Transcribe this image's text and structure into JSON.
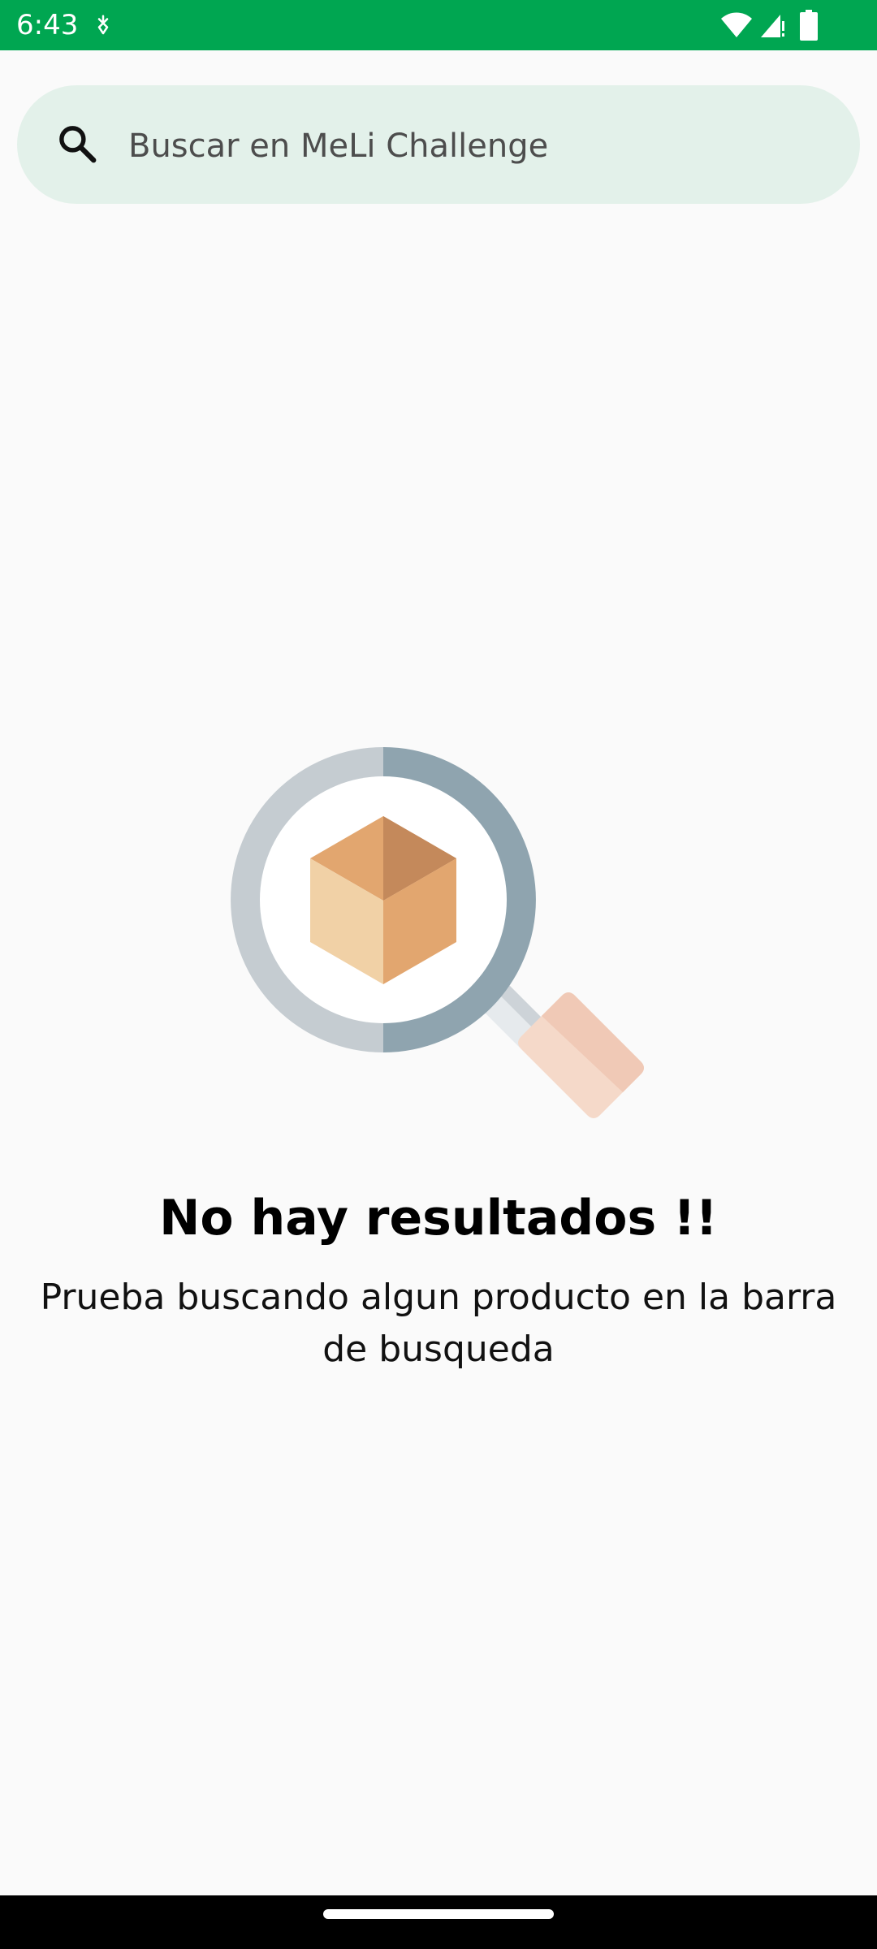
{
  "status_bar": {
    "time": "6:43",
    "color": "#00a651",
    "left_icon": "data-saver-icon",
    "right_icons": [
      "wifi-icon",
      "signal-icon",
      "battery-icon"
    ]
  },
  "search": {
    "placeholder": "Buscar en MeLi Challenge",
    "value": "",
    "icon": "search-icon"
  },
  "empty_state": {
    "title": "No hay resultados !!",
    "message": "Prueba buscando algun producto en la barra de busqueda",
    "illustration": "magnifier-box-illustration"
  },
  "navigation": {
    "type": "gesture-handle"
  }
}
